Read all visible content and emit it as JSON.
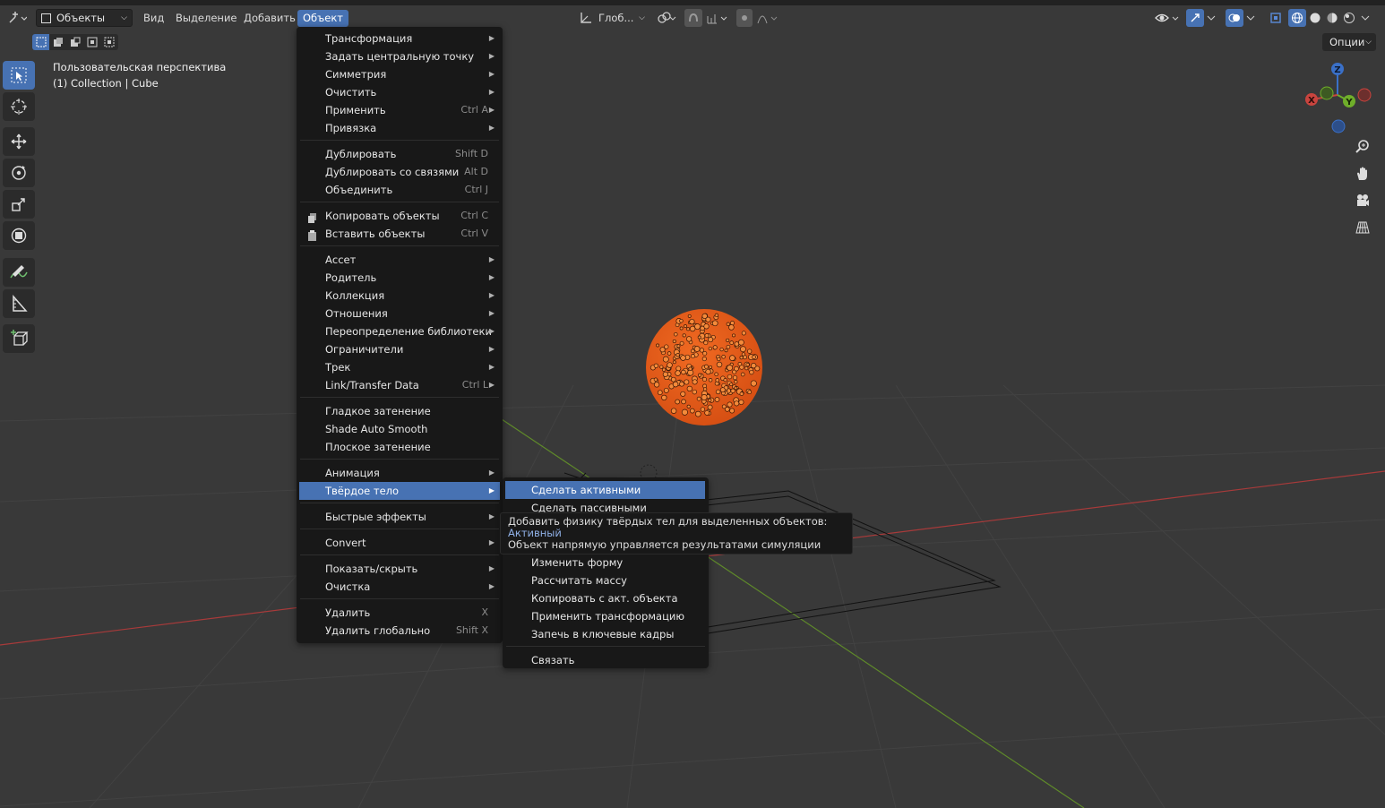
{
  "header": {
    "mode_dropdown": "Объекты",
    "menus": [
      "Вид",
      "Выделение",
      "Добавить",
      "Объект"
    ],
    "transform_orientation": "Глоб...",
    "options_label": "Опции"
  },
  "viewport_overlay": {
    "perspective": "Пользовательская перспектива",
    "collection": "(1) Collection | Cube"
  },
  "gizmo": {
    "z": "Z",
    "x": "X",
    "y": "Y"
  },
  "object_menu": {
    "items": [
      {
        "label": "Трансформация",
        "shortcut": "",
        "submenu": true
      },
      {
        "label": "Задать центральную точку",
        "shortcut": "",
        "submenu": true
      },
      {
        "label": "Симметрия",
        "shortcut": "",
        "submenu": true
      },
      {
        "label": "Очистить",
        "shortcut": "",
        "submenu": true
      },
      {
        "label": "Применить",
        "shortcut": "Ctrl A",
        "submenu": true
      },
      {
        "label": "Привязка",
        "shortcut": "",
        "submenu": true
      },
      {
        "label": "Дублировать",
        "shortcut": "Shift D",
        "submenu": false
      },
      {
        "label": "Дублировать со связями",
        "shortcut": "Alt D",
        "submenu": false
      },
      {
        "label": "Объединить",
        "shortcut": "Ctrl J",
        "submenu": false
      },
      {
        "label": "Копировать объекты",
        "shortcut": "Ctrl C",
        "submenu": false
      },
      {
        "label": "Вставить объекты",
        "shortcut": "Ctrl V",
        "submenu": false
      },
      {
        "label": "Ассет",
        "shortcut": "",
        "submenu": true
      },
      {
        "label": "Родитель",
        "shortcut": "",
        "submenu": true
      },
      {
        "label": "Коллекция",
        "shortcut": "",
        "submenu": true
      },
      {
        "label": "Отношения",
        "shortcut": "",
        "submenu": true
      },
      {
        "label": "Переопределение библиотеки",
        "shortcut": "",
        "submenu": true
      },
      {
        "label": "Ограничители",
        "shortcut": "",
        "submenu": true
      },
      {
        "label": "Трек",
        "shortcut": "",
        "submenu": true
      },
      {
        "label": "Link/Transfer Data",
        "shortcut": "Ctrl L",
        "submenu": true
      },
      {
        "label": "Гладкое затенение",
        "shortcut": "",
        "submenu": false
      },
      {
        "label": "Shade Auto Smooth",
        "shortcut": "",
        "submenu": false
      },
      {
        "label": "Плоское затенение",
        "shortcut": "",
        "submenu": false
      },
      {
        "label": "Анимация",
        "shortcut": "",
        "submenu": true
      },
      {
        "label": "Твёрдое тело",
        "shortcut": "",
        "submenu": true
      },
      {
        "label": "Быстрые эффекты",
        "shortcut": "",
        "submenu": true
      },
      {
        "label": "Convert",
        "shortcut": "",
        "submenu": true
      },
      {
        "label": "Показать/скрыть",
        "shortcut": "",
        "submenu": true
      },
      {
        "label": "Очистка",
        "shortcut": "",
        "submenu": true
      },
      {
        "label": "Удалить",
        "shortcut": "X",
        "submenu": false
      },
      {
        "label": "Удалить глобально",
        "shortcut": "Shift X",
        "submenu": false
      }
    ]
  },
  "rigid_body_menu": {
    "items": [
      "Сделать активными",
      "Сделать пассивными",
      "Изменить форму",
      "Рассчитать массу",
      "Копировать с акт. объекта",
      "Применить трансформацию",
      "Запечь в ключевые кадры",
      "Связать"
    ]
  },
  "tooltip": {
    "line1": "Добавить физику твёрдых тел для выделенных объектов:",
    "value": "Активный",
    "line2": "Объект напрямую управляется результатами симуляции"
  },
  "colors": {
    "accent": "#4772b3",
    "sphere": "#e8581a",
    "menu_bg": "#181818",
    "viewport_bg": "#3a3a3a"
  }
}
